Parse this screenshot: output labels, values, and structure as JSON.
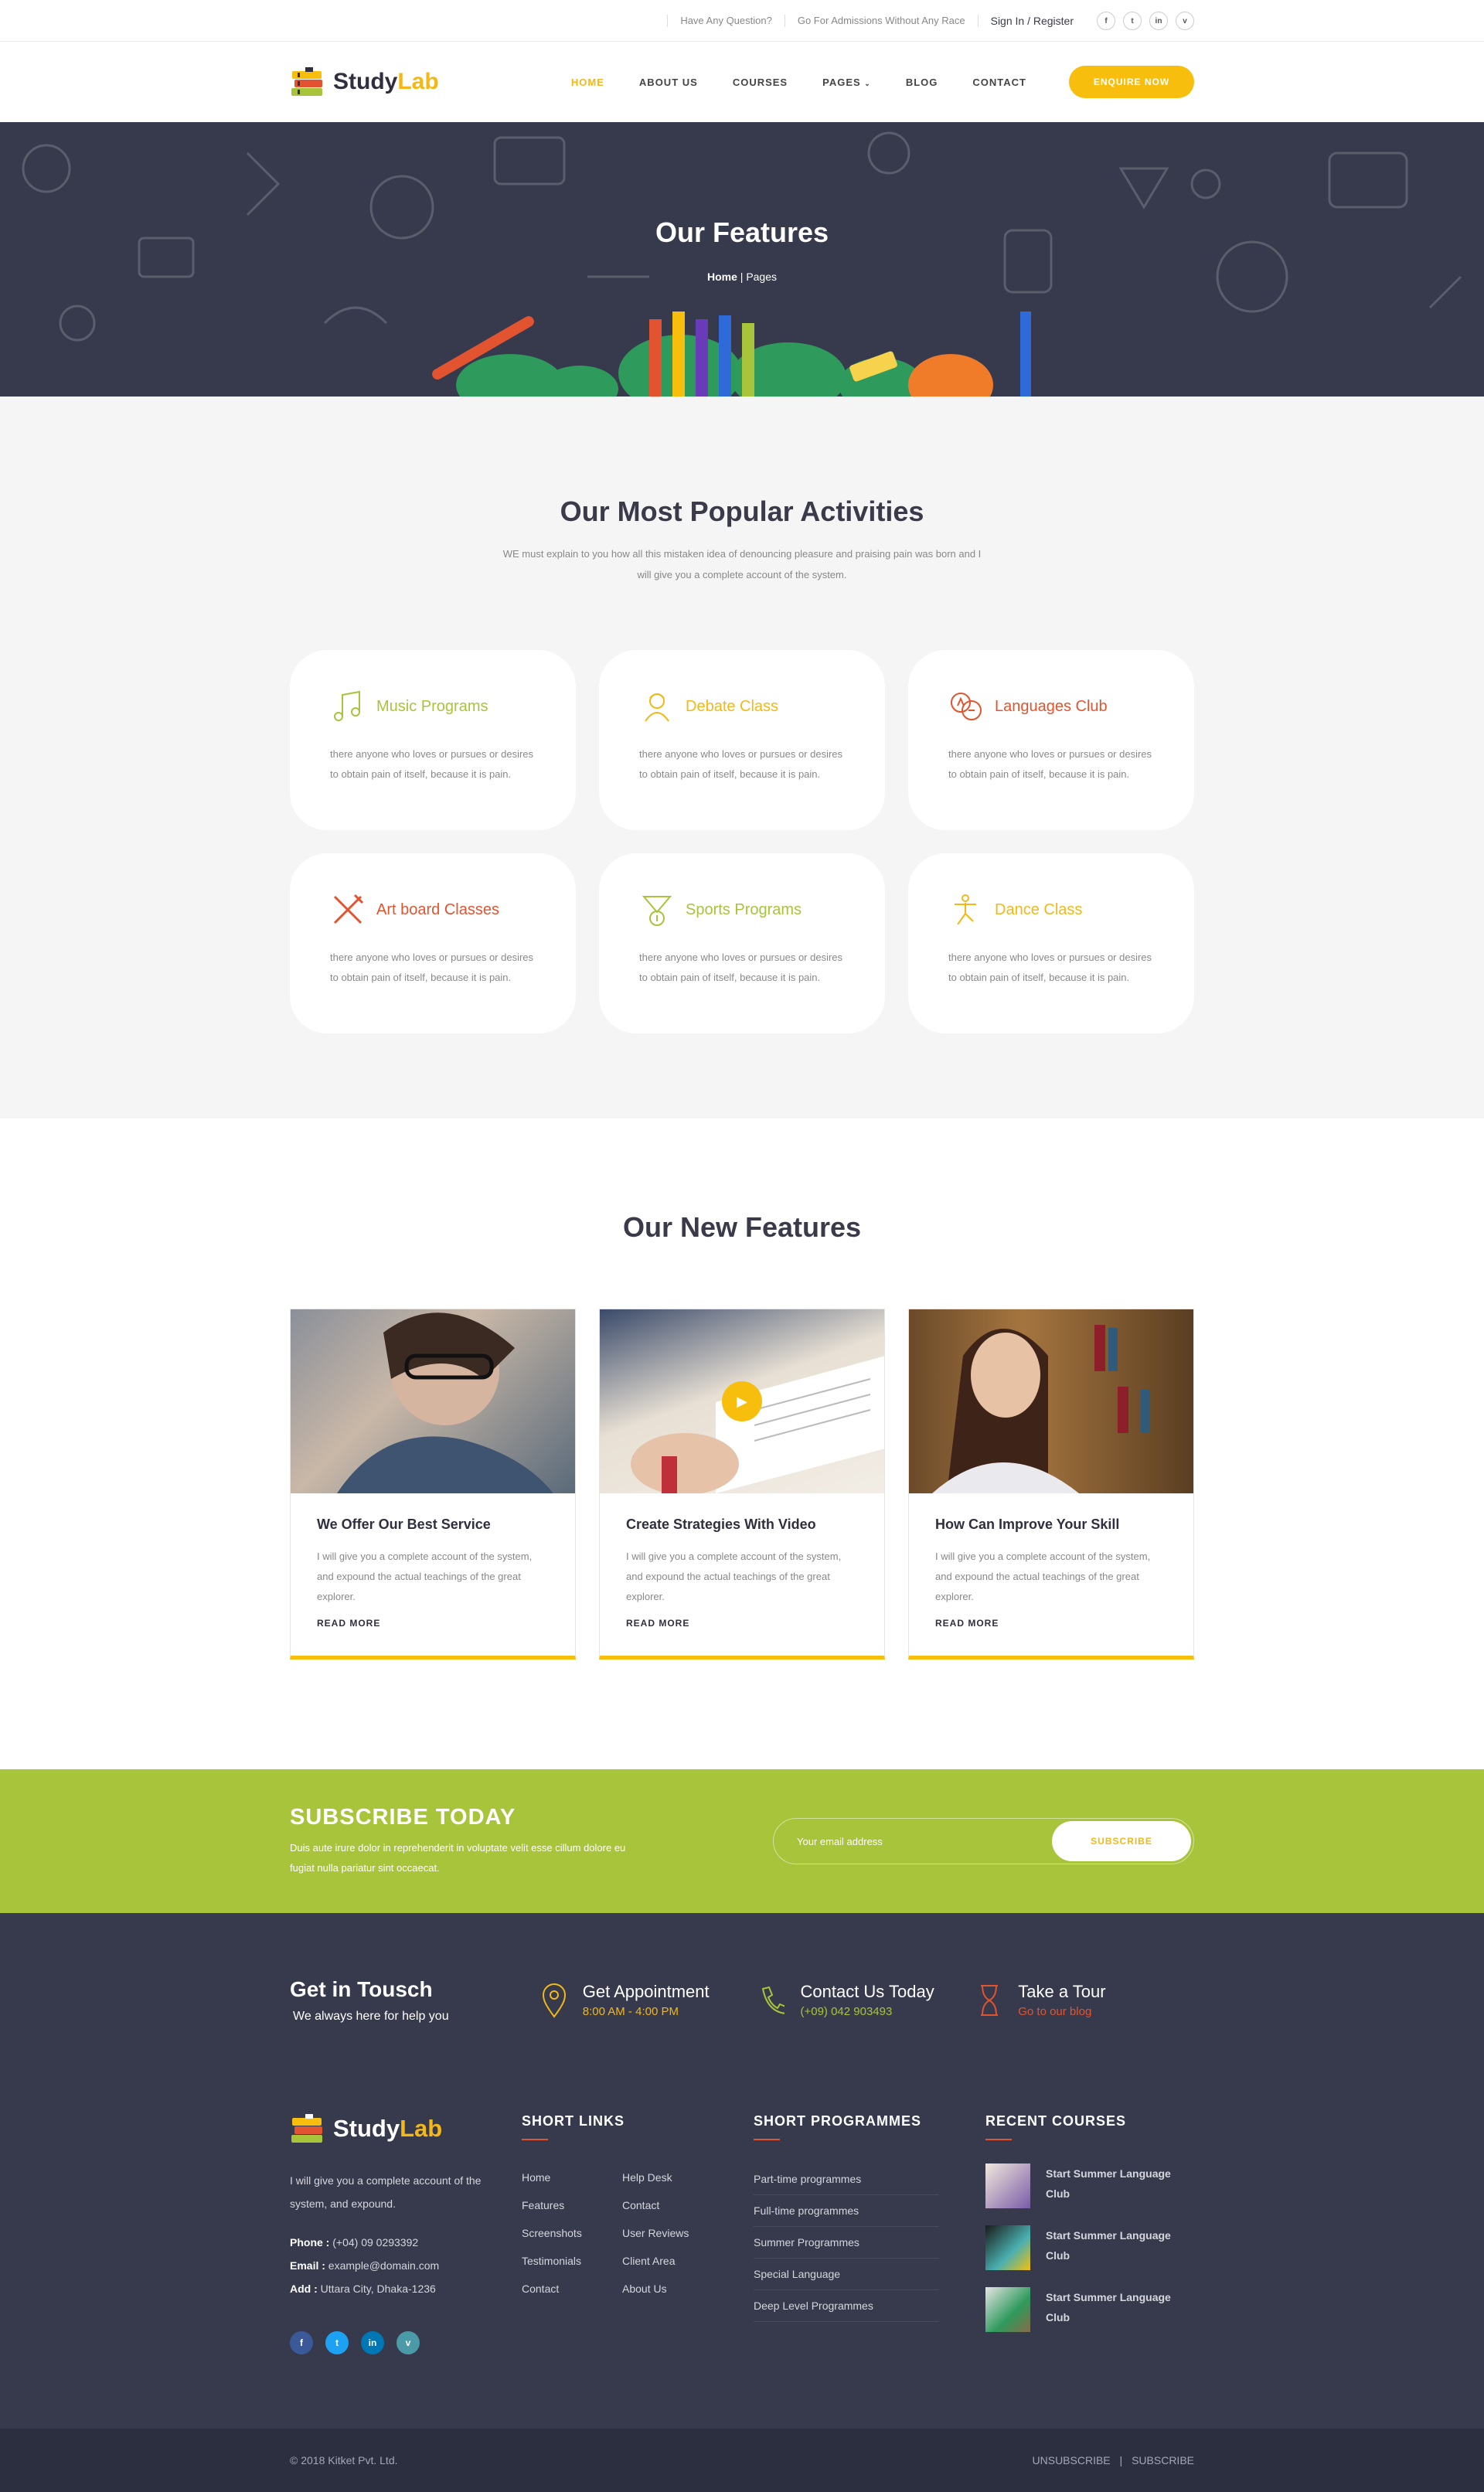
{
  "topbar": {
    "question": "Have Any Question?",
    "admission": "Go For Admissions Without Any Race",
    "sign": "Sign In / Register",
    "social": [
      "f",
      "t",
      "in",
      "v"
    ]
  },
  "brand": {
    "part1": "Study",
    "part2": "Lab"
  },
  "nav": {
    "items": [
      "HOME",
      "ABOUT US",
      "COURSES",
      "PAGES",
      "BLOG",
      "CONTACT"
    ],
    "enquire": "ENQUIRE NOW"
  },
  "hero": {
    "title": "Our Features",
    "crumb_home": "Home",
    "crumb_sep": "|",
    "crumb_page": "Pages"
  },
  "activities": {
    "title": "Our Most Popular Activities",
    "subtitle": "WE must explain to you how all this mistaken idea of denouncing pleasure and praising pain was born and I will give you a complete account of the system.",
    "cards": [
      {
        "title": "Music Programs",
        "icon": "music-note-icon",
        "color": "#a7c43a",
        "text": "there anyone who loves or pursues or desires to obtain pain of itself, because it is pain."
      },
      {
        "title": "Debate Class",
        "icon": "debate-person-icon",
        "color": "#f3b817",
        "text": "there anyone who loves or pursues or desires to obtain pain of itself, because it is pain."
      },
      {
        "title": "Languages Club",
        "icon": "languages-icon",
        "color": "#e2542f",
        "text": "there anyone who loves or pursues or desires to obtain pain of itself, because it is pain."
      },
      {
        "title": "Art board Classes",
        "icon": "brush-pencil-icon",
        "color": "#e2542f",
        "text": "there anyone who loves or pursues or desires to obtain pain of itself, because it is pain."
      },
      {
        "title": "Sports Programs",
        "icon": "trophy-medal-icon",
        "color": "#a7c43a",
        "text": "there anyone who loves or pursues or desires to obtain pain of itself, because it is pain."
      },
      {
        "title": "Dance Class",
        "icon": "dancer-icon",
        "color": "#f3b817",
        "text": "there anyone who loves or pursues or desires to obtain pain of itself, because it is pain."
      }
    ]
  },
  "features": {
    "title": "Our New Features",
    "cards": [
      {
        "title": "We Offer Our Best Service",
        "text": "I will give you a complete account of the system, and expound the actual teachings of the great explorer.",
        "more": "READ MORE"
      },
      {
        "title": "Create Strategies With Video",
        "text": "I will give you a complete account of the system, and expound the actual teachings of the great explorer.",
        "more": "READ MORE"
      },
      {
        "title": "How Can Improve Your Skill",
        "text": "I will give you a complete account of the system, and expound the actual teachings of the great explorer.",
        "more": "READ MORE"
      }
    ]
  },
  "subscribe": {
    "title": "SUBSCRIBE TODAY",
    "text": "Duis aute irure dolor in reprehenderit in voluptate velit esse cillum dolore eu fugiat nulla pariatur sint occaecat.",
    "placeholder": "Your email address",
    "button": "SUBSCRIBE"
  },
  "contact": {
    "title": "Get in Tousch",
    "subtitle": "We always here for help you",
    "items": [
      {
        "title": "Get Appointment",
        "sub": "8:00 AM - 4:00 PM",
        "color": "#f3b817",
        "icon": "map-pin-icon"
      },
      {
        "title": "Contact Us Today",
        "sub": "(+09) 042 903493",
        "color": "#a7c43a",
        "icon": "phone-icon"
      },
      {
        "title": "Take a Tour",
        "sub": "Go to our blog",
        "color": "#e2542f",
        "icon": "hourglass-icon"
      }
    ]
  },
  "footer": {
    "about": "I will give you a complete account of the system, and expound.",
    "phone_label": "Phone :",
    "phone": "(+04) 09 0293392",
    "email_label": "Email :",
    "email": "example@domain.com",
    "add_label": "Add :",
    "address": "Uttara City, Dhaka-1236",
    "social": [
      "f",
      "t",
      "in",
      "v"
    ],
    "short_links_title": "SHORT LINKS",
    "short_links": [
      "Home",
      "Help Desk",
      "Features",
      "Contact",
      "Screenshots",
      "User Reviews",
      "Testimonials",
      "Client Area",
      "Contact",
      "About Us"
    ],
    "programmes_title": "SHORT PROGRAMMES",
    "programmes": [
      "Part-time programmes",
      "Full-time programmes",
      "Summer Programmes",
      "Special Language",
      "Deep Level Programmes"
    ],
    "recent_title": "RECENT COURSES",
    "recent": [
      "Start Summer Language Club",
      "Start Summer Language Club",
      "Start Summer Language Club"
    ],
    "copyright": "© 2018 Kitket Pvt. Ltd.",
    "unsubscribe": "UNSUBSCRIBE",
    "sep": "|",
    "subscribe": "SUBSCRIBE"
  }
}
